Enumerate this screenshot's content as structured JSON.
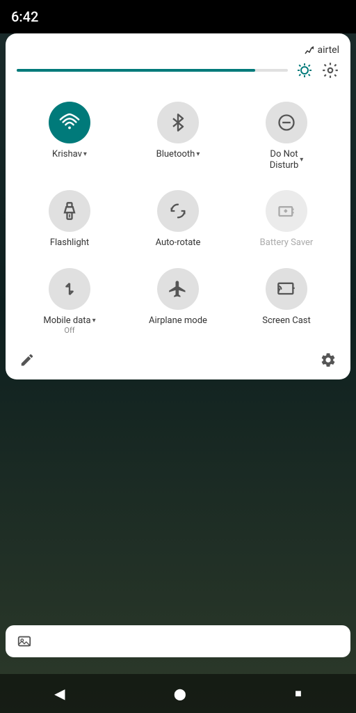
{
  "statusBar": {
    "time": "6:42",
    "carrier": "airtel"
  },
  "brightness": {
    "fillPercent": 88
  },
  "tiles": [
    {
      "id": "wifi",
      "label": "Krishav",
      "sublabel": "",
      "state": "active",
      "hasDropdown": true,
      "icon": "wifi"
    },
    {
      "id": "bluetooth",
      "label": "Bluetooth",
      "sublabel": "",
      "state": "inactive",
      "hasDropdown": true,
      "icon": "bluetooth"
    },
    {
      "id": "dnd",
      "label": "Do Not",
      "label2": "Disturb",
      "sublabel": "",
      "state": "inactive",
      "hasDropdown": true,
      "icon": "dnd"
    },
    {
      "id": "flashlight",
      "label": "Flashlight",
      "sublabel": "",
      "state": "inactive",
      "hasDropdown": false,
      "icon": "flashlight"
    },
    {
      "id": "autorotate",
      "label": "Auto-rotate",
      "sublabel": "",
      "state": "inactive",
      "hasDropdown": false,
      "icon": "rotate"
    },
    {
      "id": "batterysaver",
      "label": "Battery Saver",
      "sublabel": "",
      "state": "disabled",
      "hasDropdown": false,
      "icon": "battery"
    },
    {
      "id": "mobiledata",
      "label": "Mobile data",
      "sublabel": "Off",
      "state": "inactive",
      "hasDropdown": true,
      "icon": "mobiledata"
    },
    {
      "id": "airplane",
      "label": "Airplane mode",
      "sublabel": "",
      "state": "inactive",
      "hasDropdown": false,
      "icon": "airplane"
    },
    {
      "id": "screencast",
      "label": "Screen Cast",
      "sublabel": "",
      "state": "inactive",
      "hasDropdown": false,
      "icon": "cast"
    }
  ],
  "bottomBar": {
    "editLabel": "edit",
    "settingsLabel": "settings"
  },
  "nav": {
    "back": "◀",
    "home": "⬤",
    "recent": "■"
  }
}
